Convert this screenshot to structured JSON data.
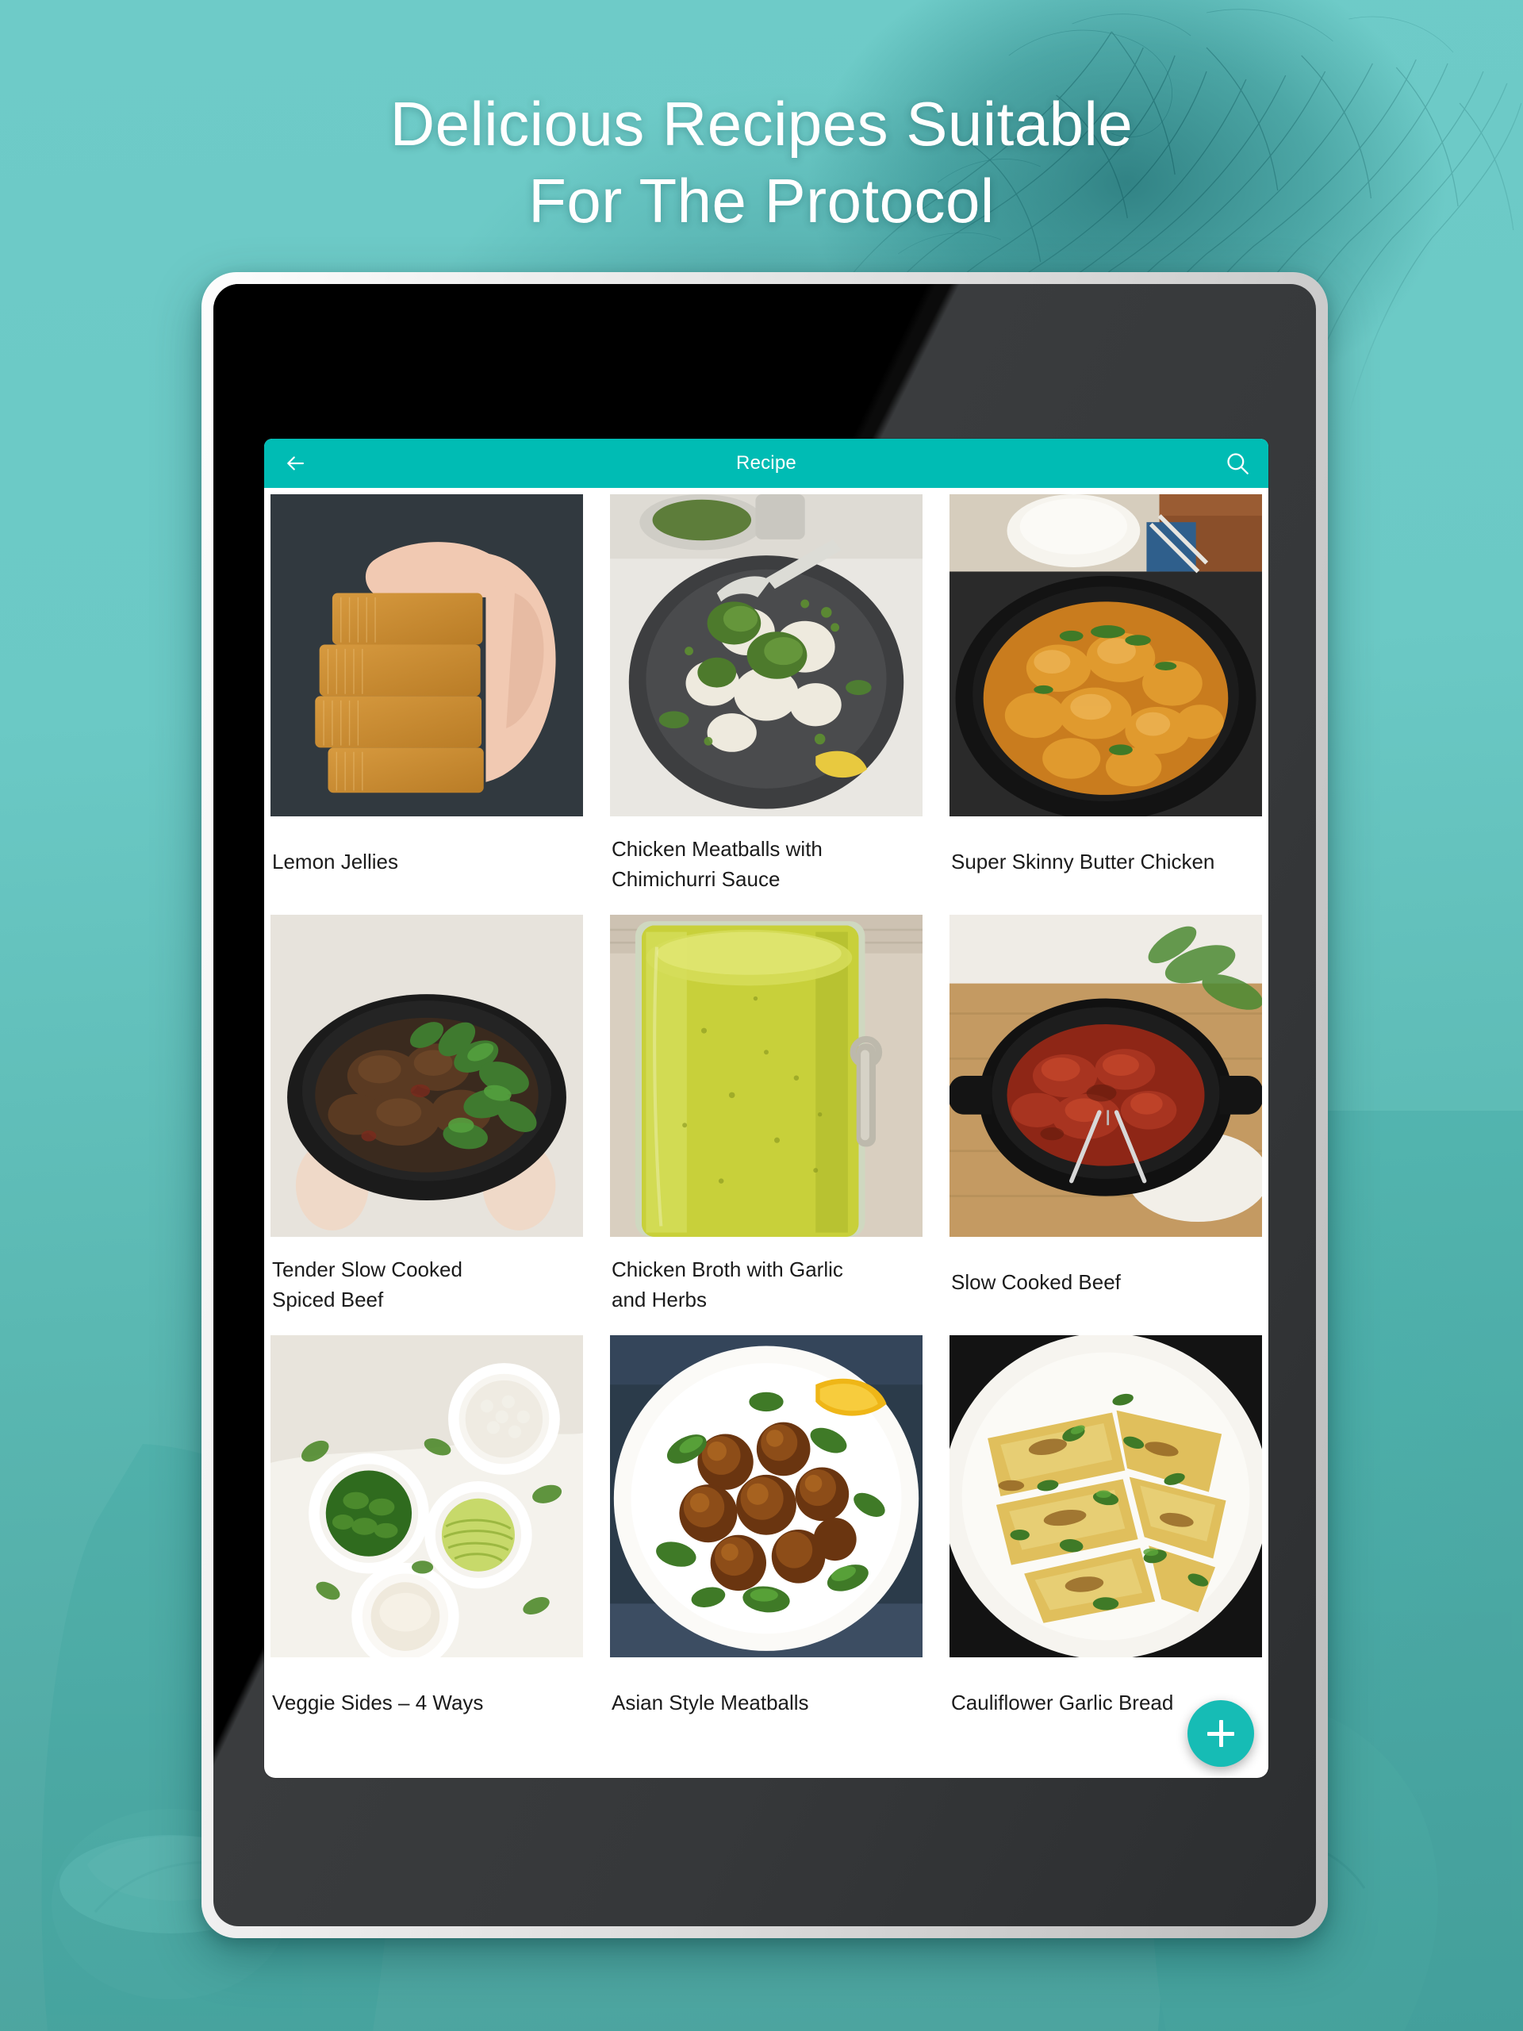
{
  "promo": {
    "title_line1": "Delicious Recipes Suitable",
    "title_line2": "For The Protocol",
    "background_color": "#6bcac6",
    "accent_color": "#00bcb4"
  },
  "device": {
    "type": "tablet",
    "bezel_color": "#e8e8e8",
    "screen_color": "#000000"
  },
  "app": {
    "app_bar": {
      "title": "Recipe",
      "back_icon": "arrow-left-icon",
      "search_icon": "search-icon",
      "background_color": "#00bcb4",
      "text_color": "#ffffff"
    },
    "fab": {
      "label": "+",
      "icon": "plus-icon",
      "color": "#16bcb5"
    },
    "grid": {
      "columns": 3,
      "rows": 3,
      "items": [
        {
          "title": "Lemon Jellies",
          "image": "lemon-jellies-photo"
        },
        {
          "title": "Chicken Meatballs with\nChimichurri Sauce",
          "image": "chicken-meatballs-chimichurri-photo"
        },
        {
          "title": "Super Skinny Butter Chicken",
          "image": "butter-chicken-photo"
        },
        {
          "title": "Tender Slow Cooked\nSpiced Beef",
          "image": "tender-slow-cooked-spiced-beef-photo"
        },
        {
          "title": "Chicken Broth with Garlic\nand Herbs",
          "image": "chicken-broth-garlic-herbs-photo"
        },
        {
          "title": "Slow Cooked Beef",
          "image": "slow-cooked-beef-photo"
        },
        {
          "title": "Veggie Sides – 4 Ways",
          "image": "veggie-sides-photo"
        },
        {
          "title": "Asian Style Meatballs",
          "image": "asian-style-meatballs-photo"
        },
        {
          "title": "Cauliflower Garlic Bread",
          "image": "cauliflower-garlic-bread-photo"
        }
      ]
    }
  }
}
